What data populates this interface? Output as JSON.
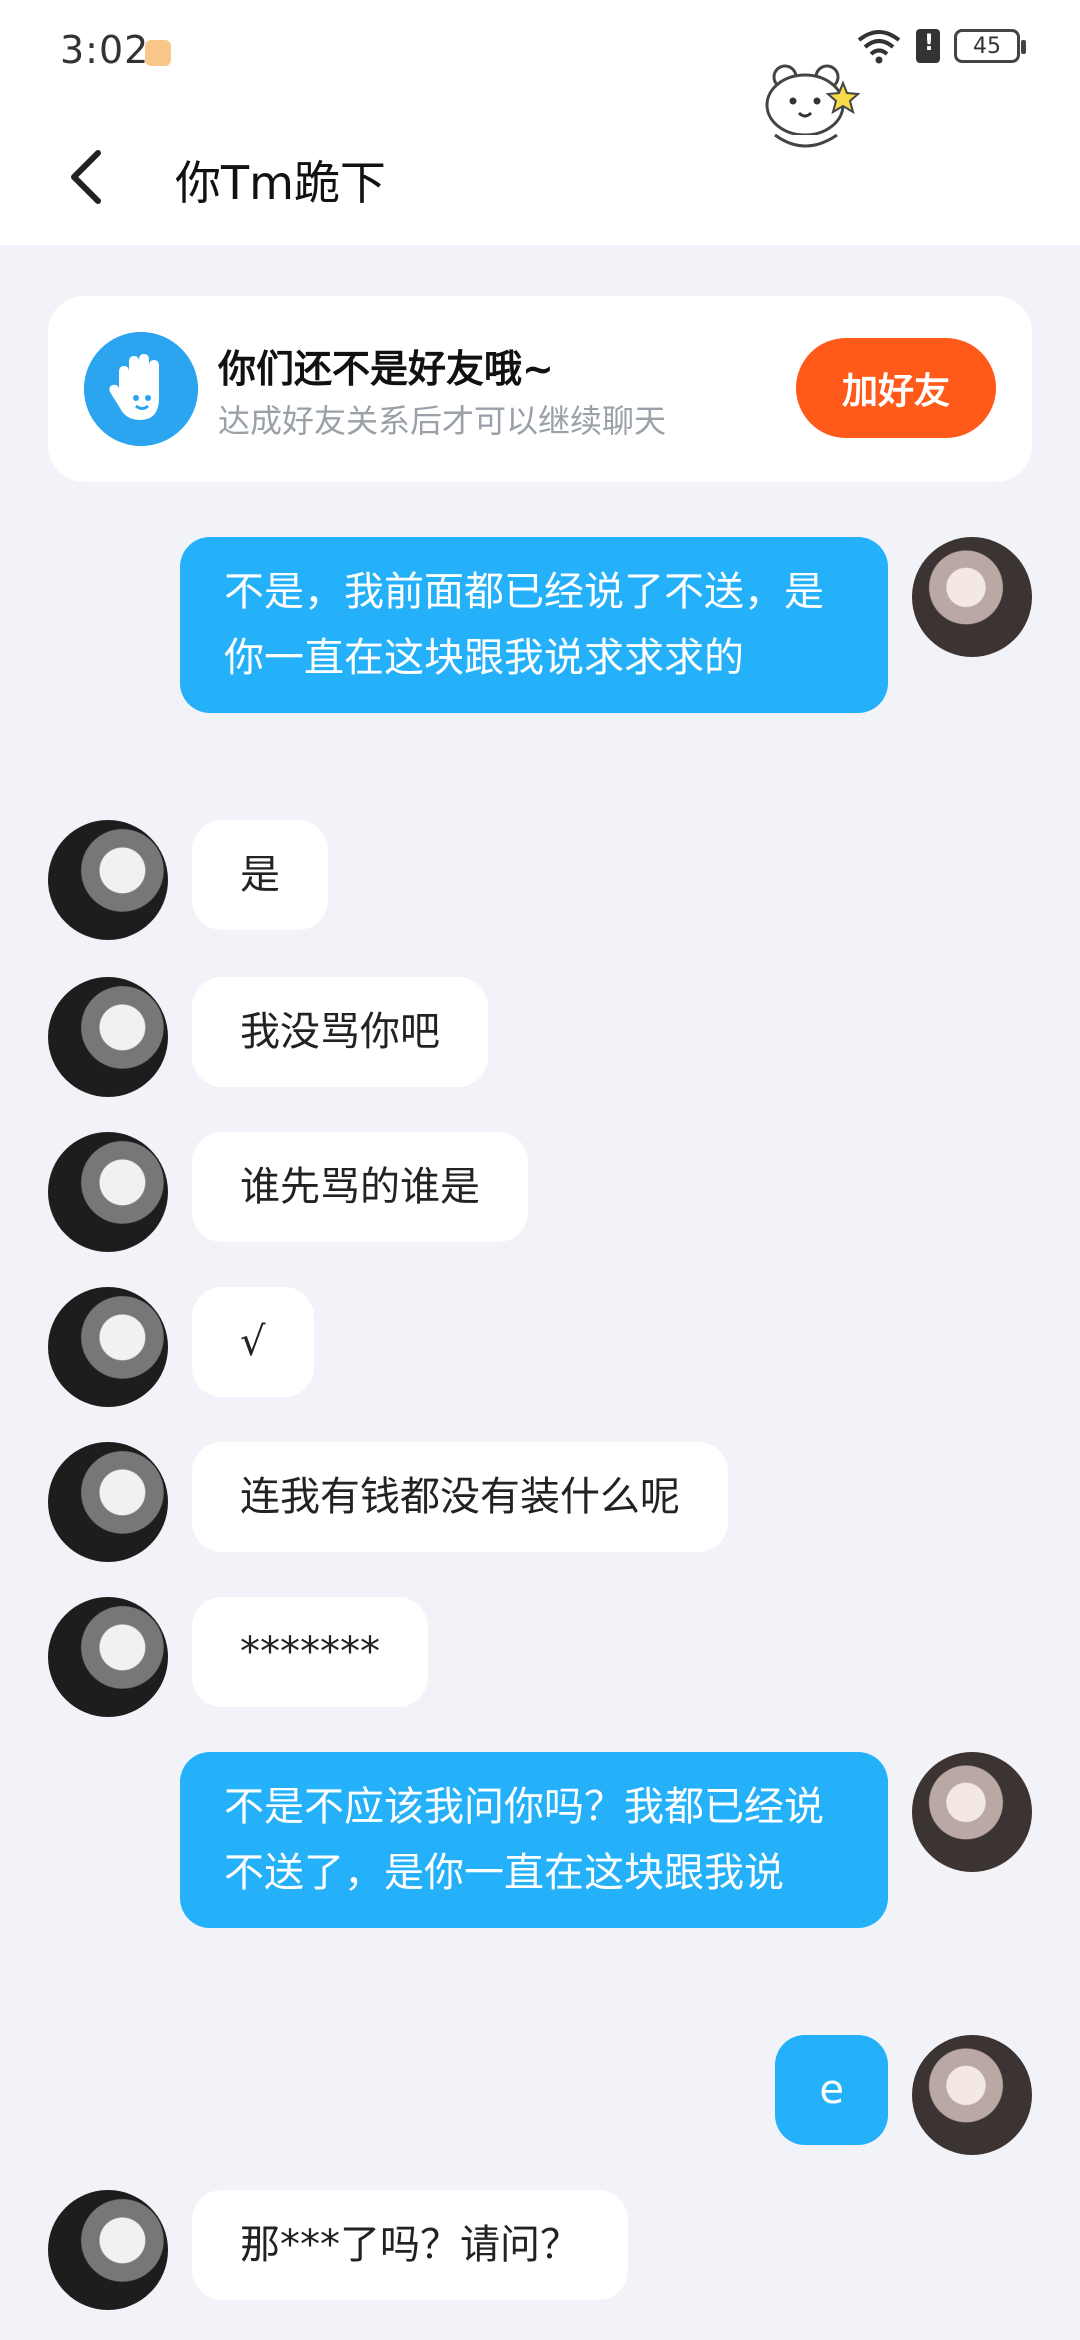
{
  "status_bar": {
    "time": "3:02",
    "battery": "45"
  },
  "header": {
    "title": "你Tm跪下"
  },
  "friend_card": {
    "title": "你们还不是好友哦~",
    "subtitle": "达成好友关系后才可以继续聊天",
    "add_button": "加好友"
  },
  "messages": [
    {
      "side": "out",
      "text": "不是，我前面都已经说了不送，是你一直在这块跟我说求求求的"
    },
    {
      "side": "in",
      "text": "是"
    },
    {
      "side": "in",
      "text": "我没骂你吧"
    },
    {
      "side": "in",
      "text": "谁先骂的谁是"
    },
    {
      "side": "in",
      "text": "√"
    },
    {
      "side": "in",
      "text": "连我有钱都没有装什么呢"
    },
    {
      "side": "in",
      "text": "*******"
    },
    {
      "side": "out",
      "text": "不是不应该我问你吗？我都已经说不送了，是你一直在这块跟我说"
    },
    {
      "side": "out",
      "text": "e"
    },
    {
      "side": "in",
      "text": "那***了吗？请问？"
    }
  ],
  "colors": {
    "accent": "#25b1f9",
    "add_button": "#ff5a1a",
    "background": "#f2f3f8"
  },
  "icons": [
    "wifi-icon",
    "sim-icon",
    "battery-icon",
    "back-arrow-icon",
    "bear-sticker-icon",
    "wave-hand-icon"
  ]
}
